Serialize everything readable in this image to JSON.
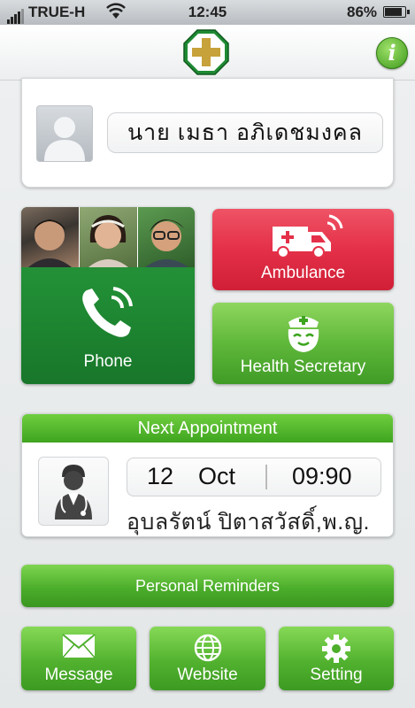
{
  "status_bar": {
    "carrier": "TRUE-H",
    "time": "12:45",
    "battery": "86%"
  },
  "header": {
    "logo_icon": "green-cross-logo-icon",
    "info_icon": "i"
  },
  "profile": {
    "name": "นาย เมธา อภิเดชมงคล",
    "avatar_icon": "person-silhouette-icon"
  },
  "tiles": {
    "phone": {
      "label": "Phone",
      "icon": "phone-call-icon"
    },
    "ambulance": {
      "label": "Ambulance",
      "icon": "ambulance-icon"
    },
    "secretary": {
      "label": "Health Secretary",
      "icon": "nurse-icon"
    }
  },
  "appointment": {
    "title": "Next Appointment",
    "day": "12",
    "month": "Oct",
    "time": "09:90",
    "doctor": "อุบลรัตน์ ปิตาสวัสดิ์,พ.ญ."
  },
  "reminders": {
    "label": "Personal Reminders"
  },
  "bottom": {
    "message": "Message",
    "website": "Website",
    "setting": "Setting"
  },
  "colors": {
    "green": "#3ea41f",
    "red": "#e43048",
    "phone_green": "#1f8a33"
  }
}
